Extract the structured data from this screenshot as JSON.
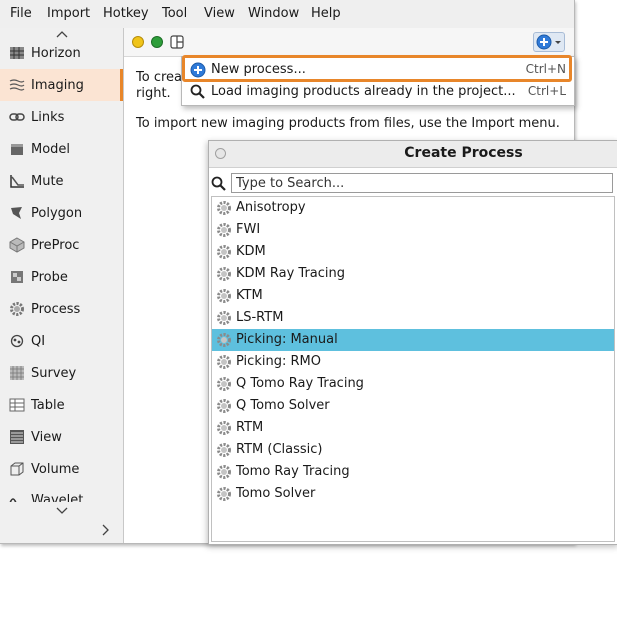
{
  "menubar": {
    "items": [
      "File",
      "Import",
      "Hotkey",
      "Tool",
      "View",
      "Window",
      "Help"
    ]
  },
  "sidebar": {
    "items": [
      {
        "label": "Horizon",
        "icon": "horizon-icon"
      },
      {
        "label": "Imaging",
        "icon": "imaging-icon",
        "active": true
      },
      {
        "label": "Links",
        "icon": "links-icon"
      },
      {
        "label": "Model",
        "icon": "model-icon"
      },
      {
        "label": "Mute",
        "icon": "mute-icon"
      },
      {
        "label": "Polygon",
        "icon": "polygon-icon"
      },
      {
        "label": "PreProc",
        "icon": "preproc-icon"
      },
      {
        "label": "Probe",
        "icon": "probe-icon"
      },
      {
        "label": "Process",
        "icon": "process-icon"
      },
      {
        "label": "QI",
        "icon": "qi-icon"
      },
      {
        "label": "Survey",
        "icon": "survey-icon"
      },
      {
        "label": "Table",
        "icon": "table-icon"
      },
      {
        "label": "View",
        "icon": "view-icon"
      },
      {
        "label": "Volume",
        "icon": "volume-icon"
      },
      {
        "label": "Wavelet",
        "icon": "wavelet-icon"
      }
    ]
  },
  "content": {
    "line1_prefix": "To crea",
    "line1_suffix": "right.",
    "line2": "To import new imaging products from files, use the Import menu."
  },
  "dropdown": {
    "items": [
      {
        "label": "New process...",
        "shortcut": "Ctrl+N",
        "icon": "add-circle-icon"
      },
      {
        "label": "Load imaging products already in the project...",
        "shortcut": "Ctrl+L",
        "icon": "magnifier-icon"
      }
    ]
  },
  "dialog": {
    "title": "Create Process",
    "search_placeholder": "Type to Search...",
    "items": [
      "Anisotropy",
      "FWI",
      "KDM",
      "KDM Ray Tracing",
      "KTM",
      "LS-RTM",
      "Picking: Manual",
      "Picking: RMO",
      "Q Tomo Ray Tracing",
      "Q Tomo Solver",
      "RTM",
      "RTM (Classic)",
      "Tomo Ray Tracing",
      "Tomo Solver"
    ],
    "selected_index": 6
  },
  "colors": {
    "accent": "#e8862a",
    "selection": "#5ec0de",
    "active_nav": "#fbe4d3",
    "dot_yellow": "#f0c419",
    "dot_green": "#2e9e3a"
  }
}
